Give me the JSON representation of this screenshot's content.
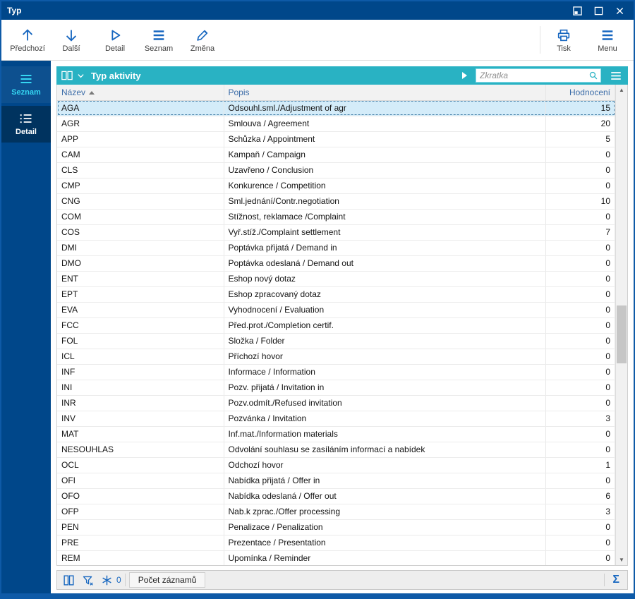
{
  "window": {
    "title": "Typ"
  },
  "toolbar": {
    "items": [
      {
        "label": "Předchozí",
        "icon": "arrow-up-icon"
      },
      {
        "label": "Další",
        "icon": "arrow-down-icon"
      },
      {
        "label": "Detail",
        "icon": "play-icon"
      },
      {
        "label": "Seznam",
        "icon": "menu-icon"
      },
      {
        "label": "Změna",
        "icon": "pencil-icon"
      }
    ],
    "right_items": [
      {
        "label": "Tisk",
        "icon": "printer-icon"
      },
      {
        "label": "Menu",
        "icon": "menu-icon"
      }
    ]
  },
  "sidebar": {
    "items": [
      {
        "label": "Seznam",
        "active": true
      },
      {
        "label": "Detail",
        "active": false
      }
    ]
  },
  "panel": {
    "title": "Typ aktivity",
    "search": {
      "placeholder": "Zkratka",
      "value": ""
    }
  },
  "table": {
    "columns": [
      "Název",
      "Popis",
      "Hodnocení"
    ],
    "sort": {
      "column": "Název",
      "direction": "asc"
    },
    "selected_row_index": 0,
    "rows": [
      [
        "AGA",
        "Odsouhl.sml./Adjustment of agr",
        "15"
      ],
      [
        "AGR",
        "Smlouva / Agreement",
        "20"
      ],
      [
        "APP",
        "Schůzka / Appointment",
        "5"
      ],
      [
        "CAM",
        "Kampaň / Campaign",
        "0"
      ],
      [
        "CLS",
        "Uzavřeno / Conclusion",
        "0"
      ],
      [
        "CMP",
        "Konkurence / Competition",
        "0"
      ],
      [
        "CNG",
        "Sml.jednání/Contr.negotiation",
        "10"
      ],
      [
        "COM",
        "Stížnost, reklamace /Complaint",
        "0"
      ],
      [
        "COS",
        "Vyř.stíž./Complaint settlement",
        "7"
      ],
      [
        "DMI",
        "Poptávka přijatá / Demand in",
        "0"
      ],
      [
        "DMO",
        "Poptávka odeslaná / Demand out",
        "0"
      ],
      [
        "ENT",
        "Eshop nový dotaz",
        "0"
      ],
      [
        "EPT",
        "Eshop zpracovaný dotaz",
        "0"
      ],
      [
        "EVA",
        "Vyhodnocení / Evaluation",
        "0"
      ],
      [
        "FCC",
        "Před.prot./Completion certif.",
        "0"
      ],
      [
        "FOL",
        "Složka / Folder",
        "0"
      ],
      [
        "ICL",
        "Příchozí hovor",
        "0"
      ],
      [
        "INF",
        "Informace / Information",
        "0"
      ],
      [
        "INI",
        "Pozv. přijatá / Invitation in",
        "0"
      ],
      [
        "INR",
        "Pozv.odmít./Refused invitation",
        "0"
      ],
      [
        "INV",
        "Pozvánka / Invitation",
        "3"
      ],
      [
        "MAT",
        "Inf.mat./Information materials",
        "0"
      ],
      [
        "NESOUHLAS",
        "Odvolání souhlasu se zasíláním informací a nabídek",
        "0"
      ],
      [
        "OCL",
        "Odchozí hovor",
        "1"
      ],
      [
        "OFI",
        "Nabídka přijatá / Offer in",
        "0"
      ],
      [
        "OFO",
        "Nabídka odeslaná / Offer out",
        "6"
      ],
      [
        "OFP",
        "Nab.k zprac./Offer processing",
        "3"
      ],
      [
        "PEN",
        "Penalizace / Penalization",
        "0"
      ],
      [
        "PRE",
        "Prezentace / Presentation",
        "0"
      ],
      [
        "REM",
        "Upomínka / Reminder",
        "0"
      ]
    ]
  },
  "statusbar": {
    "filter_count": "0",
    "records_button_label": "Počet záznamů",
    "sum_symbol": "Σ"
  },
  "colors": {
    "titlebar_blue": "#00478a",
    "sidebar_dark_tile": "#00335f",
    "sidebar_active_cyan": "#35d6f2",
    "accent_teal": "#29b2c3",
    "toolbar_icon_blue": "#1767c0",
    "selected_row": "#d4ecf9",
    "header_text_blue": "#3b6ca8"
  }
}
